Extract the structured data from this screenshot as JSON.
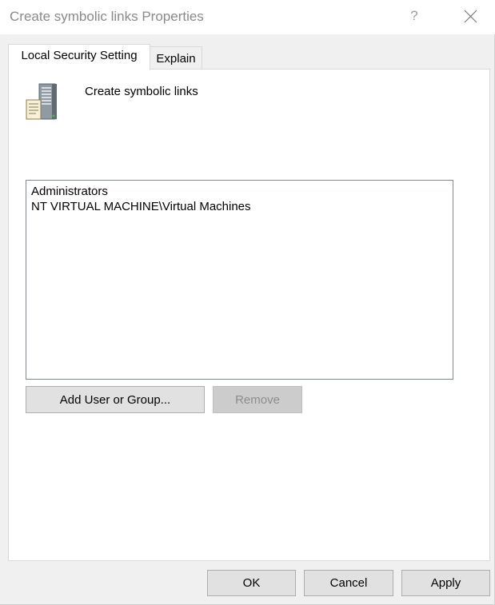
{
  "window": {
    "title": "Create symbolic links Properties",
    "help_glyph": "?",
    "close_icon": "close-icon"
  },
  "tabs": [
    {
      "label": "Local Security Setting",
      "active": true
    },
    {
      "label": "Explain",
      "active": false
    }
  ],
  "policy": {
    "icon": "server-document-icon",
    "name": "Create symbolic links"
  },
  "members": [
    "Administrators",
    "NT VIRTUAL MACHINE\\Virtual Machines"
  ],
  "actions": {
    "add_label": "Add User or Group...",
    "remove_label": "Remove",
    "remove_enabled": false
  },
  "footer": {
    "ok_label": "OK",
    "cancel_label": "Cancel",
    "apply_label": "Apply"
  },
  "colors": {
    "title_text": "#8a8a8a",
    "disabled_text": "#8d8d8d",
    "button_face": "#e1e1e1",
    "list_border": "#828790"
  }
}
